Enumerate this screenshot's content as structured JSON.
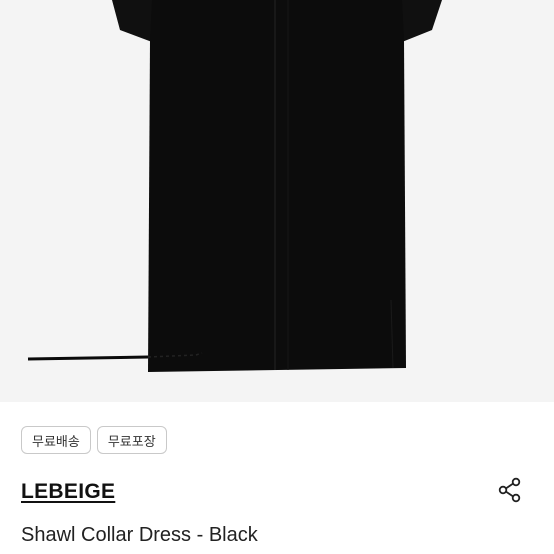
{
  "product": {
    "badges": [
      "무료배송",
      "무료포장"
    ],
    "brand": "LEBEIGE",
    "title": "Shawl Collar Dress - Black",
    "image_icon": "dress-image"
  },
  "actions": {
    "share_icon": "share-icon"
  },
  "colors": {
    "image_background": "#f4f4f4",
    "garment": "#0c0c0c",
    "badge_border": "#c9c9c9",
    "text": "#111111"
  }
}
